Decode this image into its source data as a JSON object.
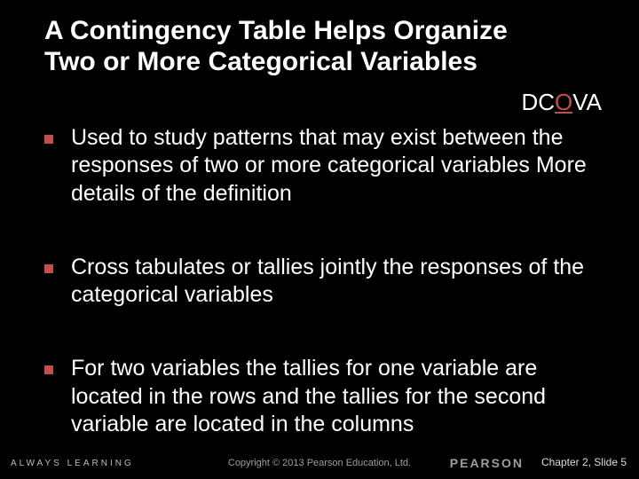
{
  "title": "A Contingency Table Helps Organize Two or More Categorical Variables",
  "dcova": {
    "pre": "DC",
    "mid": "O",
    "post": "VA"
  },
  "bullets": [
    "Used to study patterns that may exist between the responses of two or more categorical variables More details of the definition",
    "Cross tabulates or tallies jointly the responses of the categorical variables",
    "For two variables the tallies for one variable are located in the rows and the tallies for the second variable are located in the columns"
  ],
  "footer": {
    "always": "ALWAYS LEARNING",
    "copyright": "Copyright © 2013 Pearson Education, Ltd.",
    "brand": "PEARSON",
    "chapter_slide": "Chapter 2, Slide 5"
  }
}
